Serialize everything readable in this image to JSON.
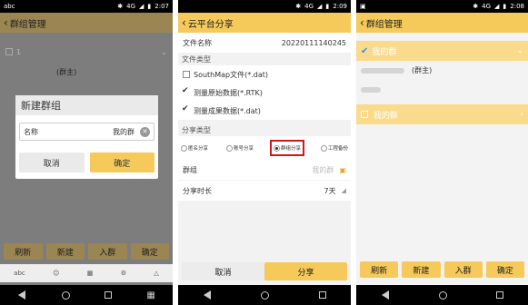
{
  "colors": {
    "accent": "#f5c95a",
    "accent_light": "#fadb8c",
    "dim_bg": "#7d7d7d",
    "highlight_red": "#d01818"
  },
  "phone1": {
    "status": {
      "left": "abc",
      "network": "4G",
      "time": "2:07"
    },
    "title": "群组管理",
    "group_row_label": "1",
    "owner_label": "(群主)",
    "dialog": {
      "title": "新建群组",
      "field_label": "名称",
      "field_value": "我的群",
      "cancel": "取消",
      "confirm": "确定"
    },
    "buttons": [
      "刷新",
      "新建",
      "入群",
      "确定"
    ],
    "keyboard": [
      "abc",
      "emoji-icon",
      "keyboard-icon",
      "settings-icon",
      "collapse-icon"
    ]
  },
  "phone2": {
    "status": {
      "network": "4G",
      "time": "2:09"
    },
    "title": "云平台分享",
    "file_name_label": "文件名称",
    "file_name_value": "20220111140245",
    "file_type_section": "文件类型",
    "file_types": [
      {
        "label": "SouthMap文件(*.dat)",
        "checked": false
      },
      {
        "label": "测量原始数据(*.RTK)",
        "checked": true
      },
      {
        "label": "测量成果数据(*.dat)",
        "checked": true
      }
    ],
    "share_type_section": "分享类型",
    "share_types": [
      {
        "label": "匿名分享",
        "selected": false
      },
      {
        "label": "账号分享",
        "selected": false
      },
      {
        "label": "群组分享",
        "selected": true
      },
      {
        "label": "工程备份",
        "selected": false
      }
    ],
    "group_label": "群组",
    "group_value": "我的群",
    "duration_label": "分享时长",
    "duration_value": "7天",
    "cancel": "取消",
    "share": "分享"
  },
  "phone3": {
    "status": {
      "network": "4G",
      "time": "2:08"
    },
    "title": "群组管理",
    "group1": "我的群",
    "owner_label": "(群主)",
    "group2": "我的群",
    "buttons": [
      "刷新",
      "新建",
      "入群",
      "确定"
    ]
  }
}
